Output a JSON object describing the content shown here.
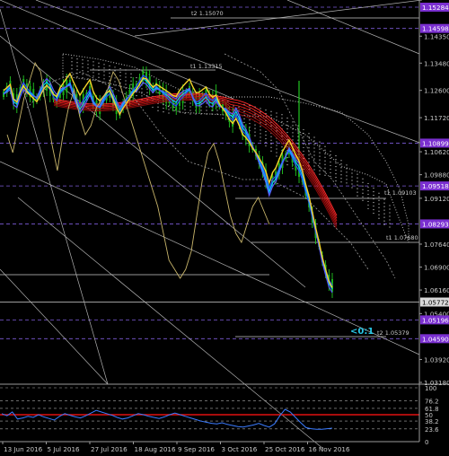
{
  "colors": {
    "background": "#000000",
    "axis_text": "#c8c8c8",
    "level_highlight": "#7a2fd0",
    "red_level_highlight": "#e01010",
    "current_price_box": "#d9d9d9",
    "label_cyan": "#29c7e6"
  },
  "chart_data": {
    "type": "line",
    "instrument_context": "price chart with indicator panel",
    "x_tick_labels": [
      "13 Jun 2016",
      "5 Jul 2016",
      "27 Jul 2016",
      "18 Aug 2016",
      "9 Sep 2016",
      "3 Oct 2016",
      "25 Oct 2016",
      "16 Nov 2016"
    ],
    "price_tick_labels": [
      "1.14350",
      "1.13480",
      "1.12600",
      "1.11720",
      "1.10620",
      "1.09880",
      "1.09120",
      "1.07640",
      "1.06900",
      "1.06160",
      "1.05400",
      "1.03920",
      "1.03180"
    ],
    "highlighted_levels": [
      {
        "label": "1.15284",
        "value": 1.15284
      },
      {
        "label": "1.14598",
        "value": 1.14598
      },
      {
        "label": "1.10899",
        "value": 1.10899
      },
      {
        "label": "1.09518",
        "value": 1.09518
      },
      {
        "label": "1.08293",
        "value": 1.08293
      },
      {
        "label": "1.05196",
        "value": 1.05196
      },
      {
        "label": "1.04590",
        "value": 1.0459
      }
    ],
    "current_price": "1.05772",
    "chart_labels": [
      {
        "text": "t2 1.15070"
      },
      {
        "text": "t1 1.13315"
      },
      {
        "text": "t1 1.09103"
      },
      {
        "text": "t1 1.07680"
      },
      {
        "text": "t2 1.05379"
      },
      {
        "text": "<0:1"
      }
    ],
    "indicator": {
      "levels": [
        "100",
        "76.2",
        "61.8",
        "50",
        "38.2",
        "23.6",
        "0"
      ],
      "values": [
        52,
        48,
        55,
        42,
        44,
        47,
        45,
        50,
        46,
        43,
        40,
        47,
        52,
        49,
        46,
        44,
        48,
        53,
        58,
        55,
        52,
        49,
        45,
        42,
        44,
        48,
        52,
        50,
        47,
        45,
        43,
        46,
        50,
        53,
        50,
        47,
        44,
        41,
        38,
        36,
        34,
        33,
        35,
        32,
        30,
        28,
        27,
        29,
        31,
        34,
        30,
        27,
        33,
        48,
        60,
        55,
        45,
        35,
        26,
        24,
        23,
        23,
        24,
        25
      ]
    }
  }
}
